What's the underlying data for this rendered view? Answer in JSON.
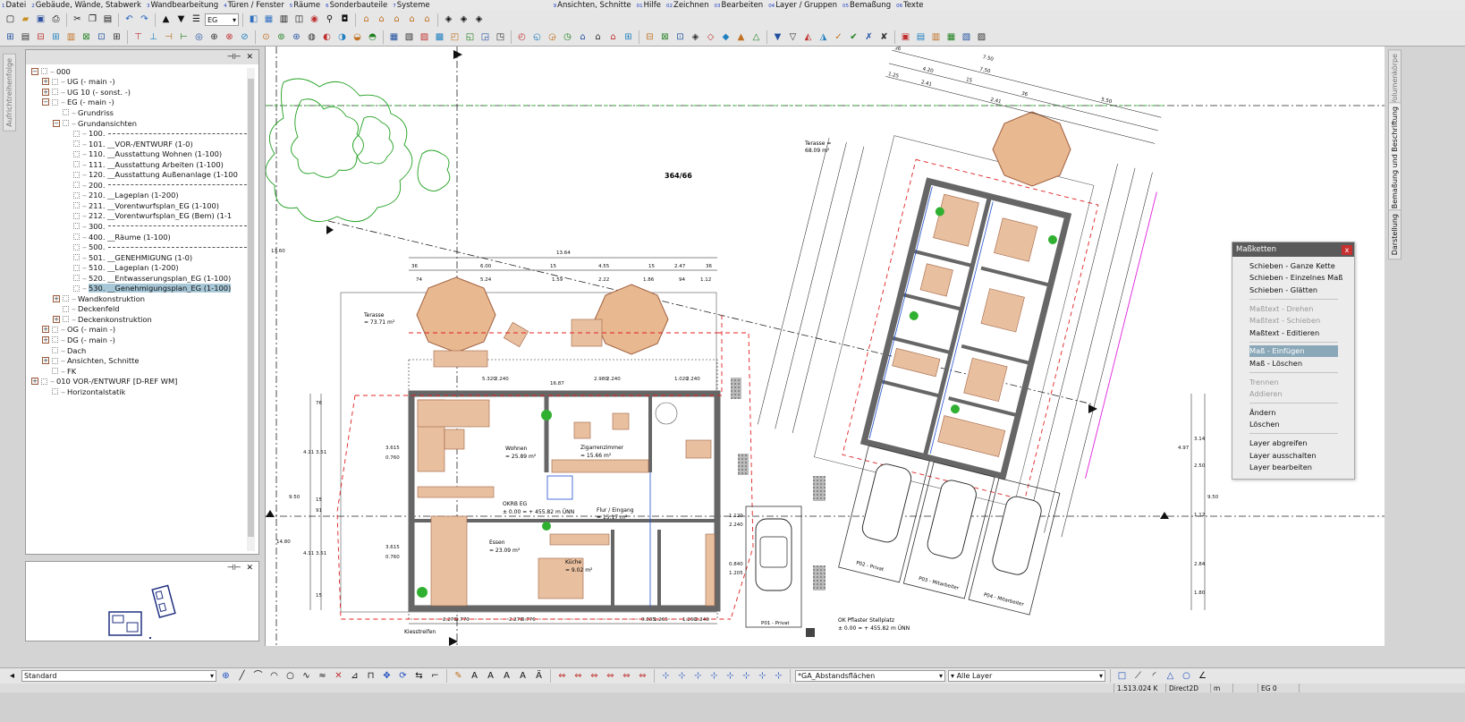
{
  "menu": [
    {
      "num": "1",
      "label": "Datei"
    },
    {
      "num": "2",
      "label": "Gebäude, Wände, Stabwerk"
    },
    {
      "num": "3",
      "label": "Wandbearbeitung"
    },
    {
      "num": "4",
      "label": "Türen / Fenster"
    },
    {
      "num": "5",
      "label": "Räume"
    },
    {
      "num": "6",
      "label": "Sonderbauteile"
    },
    {
      "num": "7",
      "label": "Systeme"
    },
    {
      "num": "9",
      "label": "Ansichten, Schnitte"
    },
    {
      "num": "01",
      "label": "Hilfe"
    },
    {
      "num": "02",
      "label": "Zeichnen"
    },
    {
      "num": "03",
      "label": "Bearbeiten"
    },
    {
      "num": "04",
      "label": "Layer / Gruppen"
    },
    {
      "num": "05",
      "label": "Bemaßung"
    },
    {
      "num": "06",
      "label": "Texte"
    }
  ],
  "toolbar": {
    "floor_select": "EG"
  },
  "left_tab": "Aufrichtreihenfolge",
  "tree": [
    {
      "lvl": 0,
      "exp": "-",
      "label": "000"
    },
    {
      "lvl": 1,
      "exp": "+",
      "label": "UG (- main -)"
    },
    {
      "lvl": 1,
      "exp": "+",
      "label": "UG 10 (- sonst. -)"
    },
    {
      "lvl": 1,
      "exp": "-",
      "label": "EG (- main -)"
    },
    {
      "lvl": 2,
      "exp": "",
      "label": "Grundriss"
    },
    {
      "lvl": 2,
      "exp": "-",
      "label": "Grundansichten"
    },
    {
      "lvl": 3,
      "exp": "",
      "label": "100. ",
      "leader": true
    },
    {
      "lvl": 3,
      "exp": "",
      "label": "101. __VOR-/ENTWURF (1-0)"
    },
    {
      "lvl": 3,
      "exp": "",
      "label": "110. __Ausstattung Wohnen (1-100)"
    },
    {
      "lvl": 3,
      "exp": "",
      "label": "111. __Ausstattung Arbeiten (1-100)"
    },
    {
      "lvl": 3,
      "exp": "",
      "label": "120. __Ausstattung Außenanlage (1-100"
    },
    {
      "lvl": 3,
      "exp": "",
      "label": "200. ",
      "leader": true
    },
    {
      "lvl": 3,
      "exp": "",
      "label": "210. __Lageplan (1-200)"
    },
    {
      "lvl": 3,
      "exp": "",
      "label": "211. __Vorentwurfsplan_EG (1-100)"
    },
    {
      "lvl": 3,
      "exp": "",
      "label": "212. __Vorentwurfsplan_EG (Bem) (1-1"
    },
    {
      "lvl": 3,
      "exp": "",
      "label": "300. ",
      "leader": true
    },
    {
      "lvl": 3,
      "exp": "",
      "label": "400. __Räume (1-100)"
    },
    {
      "lvl": 3,
      "exp": "",
      "label": "500. ",
      "leader": true
    },
    {
      "lvl": 3,
      "exp": "",
      "label": "501. __GENEHMIGUNG (1-0)"
    },
    {
      "lvl": 3,
      "exp": "",
      "label": "510. __Lageplan (1-200)"
    },
    {
      "lvl": 3,
      "exp": "",
      "label": "520. __Entwasserungsplan_EG (1-100)"
    },
    {
      "lvl": 3,
      "exp": "",
      "label": "530. __Genehmigungsplan_EG (1-100)",
      "sel": true
    },
    {
      "lvl": 2,
      "exp": "+",
      "label": "Wandkonstruktion"
    },
    {
      "lvl": 2,
      "exp": "",
      "label": "Deckenfeld"
    },
    {
      "lvl": 2,
      "exp": "+",
      "label": "Deckenkonstruktion"
    },
    {
      "lvl": 1,
      "exp": "+",
      "label": "OG (- main -)"
    },
    {
      "lvl": 1,
      "exp": "+",
      "label": "DG (- main -)"
    },
    {
      "lvl": 1,
      "exp": "",
      "label": "Dach"
    },
    {
      "lvl": 1,
      "exp": "+",
      "label": "Ansichten, Schnitte"
    },
    {
      "lvl": 1,
      "exp": "",
      "label": "FK"
    },
    {
      "lvl": 0,
      "exp": "+",
      "label": "010 VOR-/ENTWURF [D-REF WM]"
    },
    {
      "lvl": 1,
      "exp": "",
      "label": "Horizontalstatik"
    }
  ],
  "right_tabs": [
    "Volumenkörpe",
    "Bemaßung und Beschriftung",
    "Darstellung"
  ],
  "plan": {
    "parcel": "364/66",
    "terrace_left": "Terasse\n= 73.71 m²",
    "terrace_right": "Terasse =\n68.09 m²",
    "rooms": [
      {
        "name": "Wohnen",
        "area": "= 25.89 m²"
      },
      {
        "name": "Zigarrenzimmer",
        "area": "= 15.66 m²"
      },
      {
        "name": "Essen",
        "area": "= 23.09 m²"
      },
      {
        "name": "Küche",
        "area": "= 9.02 m²"
      },
      {
        "name": "Flur / Eingang",
        "area": "= 15.17 m²"
      }
    ],
    "okrb": "OKRB EG",
    "okrb_value": "± 0.00 = + 455.82 m ÜNN",
    "okrb_value_right": "± 0.00 = + 455.82 m ÜNN",
    "ok_pflaster": "OK Pflaster Stellplatz",
    "kiesstreifen": "Kiesstreifen",
    "parking": [
      "P01 - Privat",
      "P02 - Privat",
      "P03 - Mitarbeiter",
      "P04 - Mitarbeiter"
    ],
    "dims_top": [
      "13.64",
      "36",
      "6.00",
      "15",
      "4.55",
      "15",
      "2.47",
      "36",
      "74",
      "5.24",
      "1.59",
      "2.22",
      "1.86",
      "94",
      "1.12",
      "16.87"
    ],
    "dims_angled": [
      "7.50",
      "7.50",
      "5.50",
      "4.20",
      "2.41",
      "2.41",
      "1.25",
      "36",
      "15",
      "36"
    ],
    "dims_misc": [
      "3.615",
      "0.760",
      "3.615",
      "0.760",
      "1.120",
      "2.240",
      "0.840",
      "1.205",
      "2.980",
      "2.240",
      "5.320",
      "2.240",
      "1.020",
      "2.240"
    ],
    "dims_bottom": [
      "2.270",
      "0.770",
      "2.270",
      "0.770",
      "0.885",
      "1.265",
      "1.260",
      "2.240"
    ],
    "dims_left_v": [
      "14.80",
      "9.50",
      "4.11",
      "3.51",
      "4.11",
      "3.51",
      "76",
      "15",
      "91",
      "15",
      "13.60"
    ],
    "dims_right_v": [
      "3.14",
      "2.50",
      "1.12",
      "2.84",
      "1.80",
      "9.50",
      "4.97"
    ]
  },
  "context_menu": {
    "title": "Maßketten",
    "close": "x",
    "items": [
      {
        "label": "Schieben - Ganze Kette",
        "state": "normal"
      },
      {
        "label": "Schieben - Einzelnes Maß",
        "state": "normal"
      },
      {
        "label": "Schieben - Glätten",
        "state": "normal"
      },
      {
        "sep": true
      },
      {
        "label": "Maßtext - Drehen",
        "state": "disabled"
      },
      {
        "label": "Maßtext - Schieben",
        "state": "disabled"
      },
      {
        "label": "Maßtext - Editieren",
        "state": "normal"
      },
      {
        "sep": true
      },
      {
        "label": "Maß - Einfügen",
        "state": "highlight"
      },
      {
        "label": "Maß - Löschen",
        "state": "normal"
      },
      {
        "sep": true
      },
      {
        "label": "Trennen",
        "state": "disabled"
      },
      {
        "label": "Addieren",
        "state": "disabled"
      },
      {
        "sep": true
      },
      {
        "label": "Ändern",
        "state": "normal"
      },
      {
        "label": "Löschen",
        "state": "normal"
      },
      {
        "sep": true
      },
      {
        "label": "Layer abgreifen",
        "state": "normal"
      },
      {
        "label": "Layer ausschalten",
        "state": "normal"
      },
      {
        "label": "Layer bearbeiten",
        "state": "normal"
      }
    ]
  },
  "bottom": {
    "style_select": "Standard",
    "layer_select": "*GA_Abstandsflächen",
    "layer_filter": "Alle Layer"
  },
  "status": {
    "memory": "1.513.024 K",
    "mode": "Direct2D",
    "unit": "m",
    "floor": "EG 0"
  },
  "colors": {
    "wall": "#707070",
    "furniture": "#e8c0a0",
    "green": "#20a020",
    "red_dash": "#e02020",
    "blue": "#2050d0",
    "magenta": "#e020e0"
  }
}
